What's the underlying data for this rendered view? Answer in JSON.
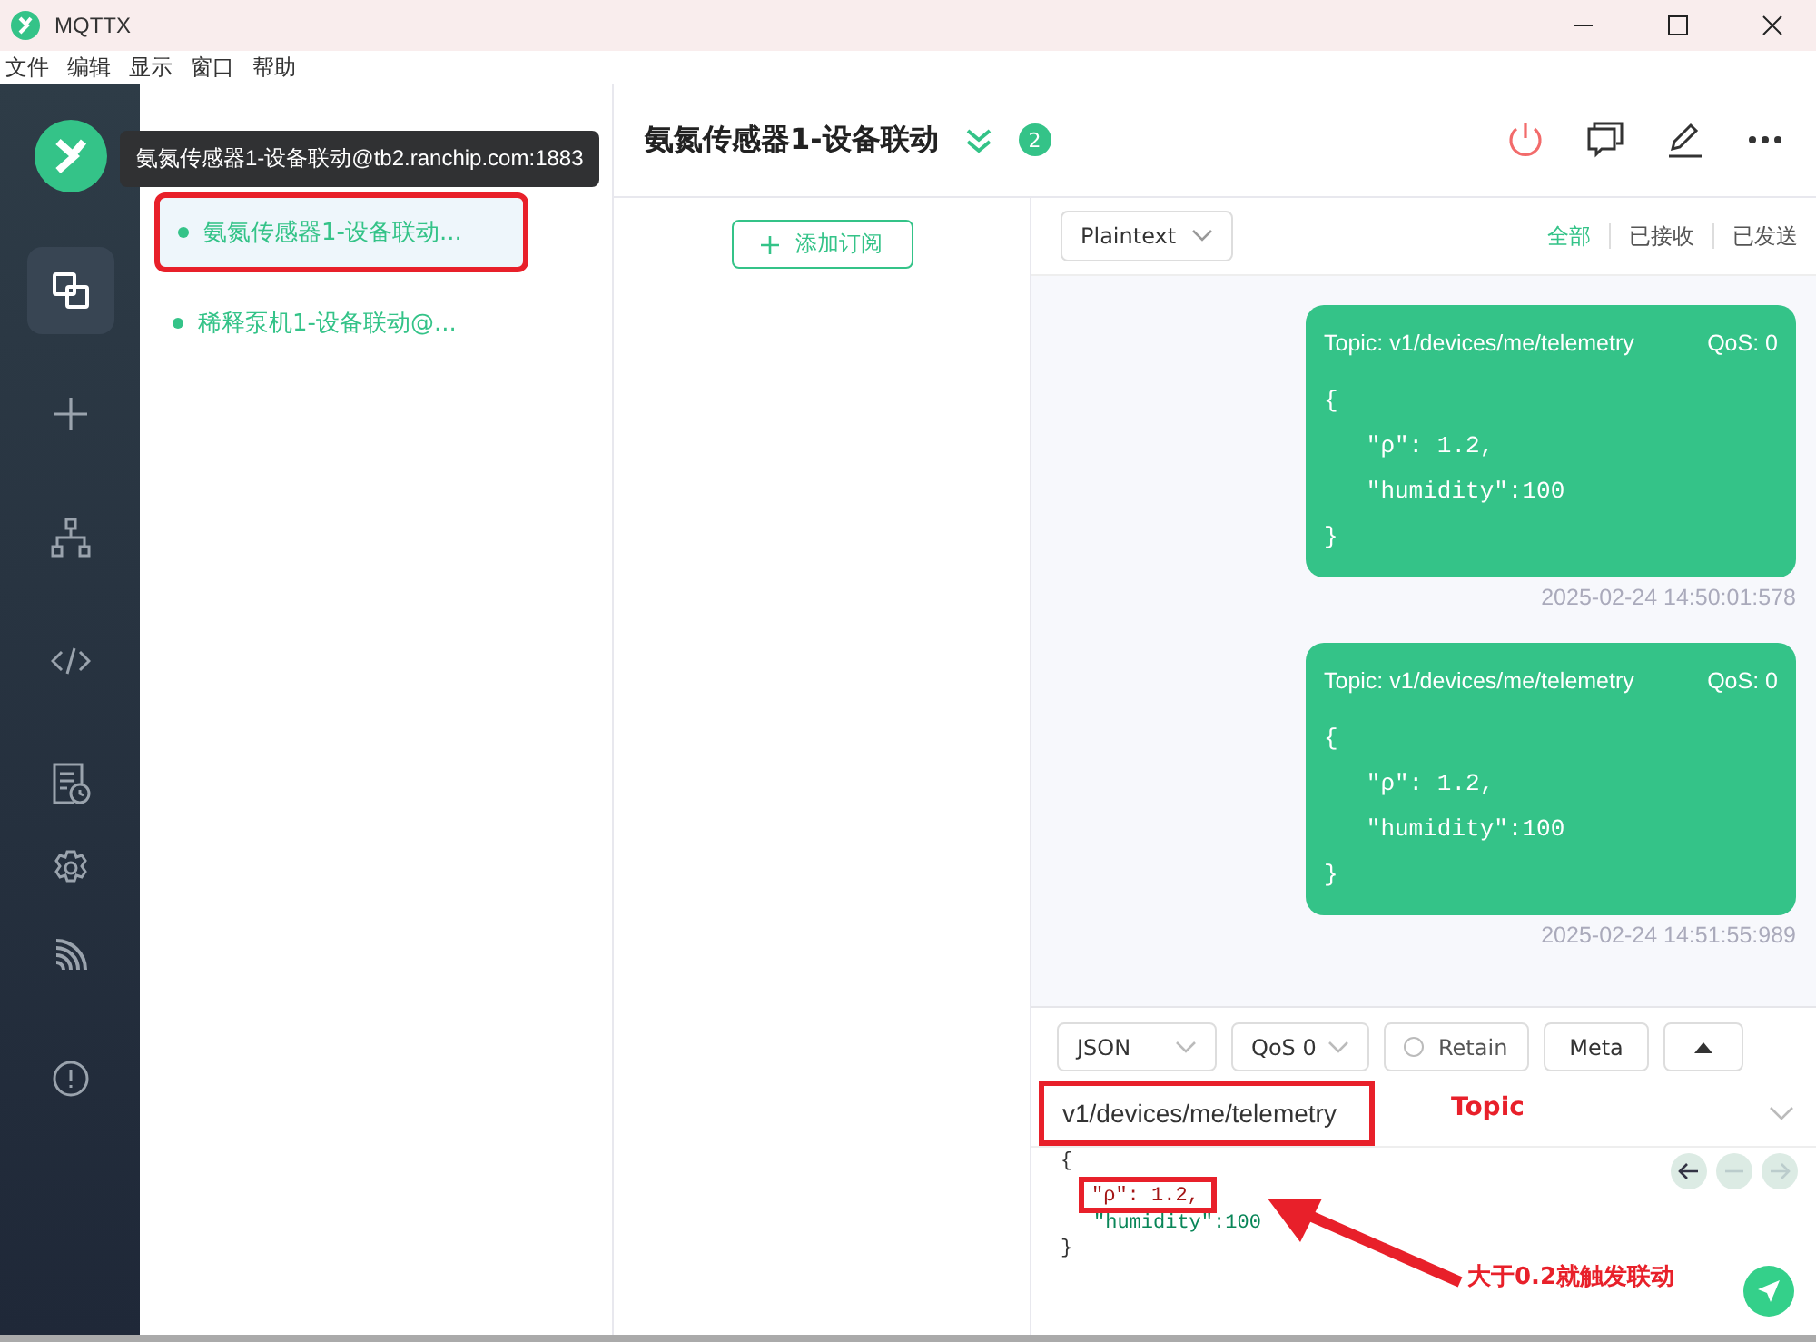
{
  "window": {
    "title": "MQTTX"
  },
  "menu": [
    "文件",
    "编辑",
    "显示",
    "窗口",
    "帮助"
  ],
  "nav": [
    {
      "kind": "connections",
      "selected": true
    },
    {
      "kind": "new",
      "selected": false
    },
    {
      "kind": "topology",
      "selected": false
    },
    {
      "kind": "script",
      "selected": false
    },
    {
      "kind": "log",
      "selected": false
    },
    {
      "kind": "settings",
      "selected": false
    },
    {
      "kind": "feed",
      "selected": false
    },
    {
      "kind": "about",
      "selected": false
    }
  ],
  "connections": {
    "tooltip": "氨氮传感器1-设备联动@tb2.ranchip.com:1883",
    "items": [
      {
        "name": "氨氮传感器1-设备联动...",
        "selected": true,
        "highlighted": true
      },
      {
        "name": "稀释泵机1-设备联动@...",
        "selected": false,
        "highlighted": false
      }
    ]
  },
  "header": {
    "title": "氨氮传感器1-设备联动",
    "count": "2"
  },
  "subscriptions": {
    "add_button": "添加订阅"
  },
  "messages": {
    "format": "Plaintext",
    "filters": [
      {
        "label": "全部",
        "selected": true
      },
      {
        "label": "已接收",
        "selected": false
      },
      {
        "label": "已发送",
        "selected": false
      }
    ],
    "items": [
      {
        "topic": "Topic: v1/devices/me/telemetry",
        "qos": "QoS: 0",
        "payload": "{\n   \"ρ\": 1.2,\n   \"humidity\":100\n}",
        "time": "2025-02-24 14:50:01:578"
      },
      {
        "topic": "Topic: v1/devices/me/telemetry",
        "qos": "QoS: 0",
        "payload": "{\n   \"ρ\": 1.2,\n   \"humidity\":100\n}",
        "time": "2025-02-24 14:51:55:989"
      }
    ]
  },
  "composer": {
    "format": "JSON",
    "qos": "QoS 0",
    "retain": {
      "label": "Retain",
      "checked": false
    },
    "meta": "Meta",
    "topic": {
      "value": "v1/devices/me/telemetry",
      "highlighted": true
    },
    "payload": [
      {
        "text": "{",
        "highlighted": false
      },
      {
        "text": "\"ρ\": 1.2,",
        "highlighted": true
      },
      {
        "text": "\"humidity\":100",
        "highlighted": false
      },
      {
        "text": "}",
        "highlighted": false
      }
    ]
  },
  "annotations": [
    {
      "kind": "label",
      "text": "Topic"
    },
    {
      "kind": "note",
      "text": "大于0.2就触发联动"
    }
  ]
}
